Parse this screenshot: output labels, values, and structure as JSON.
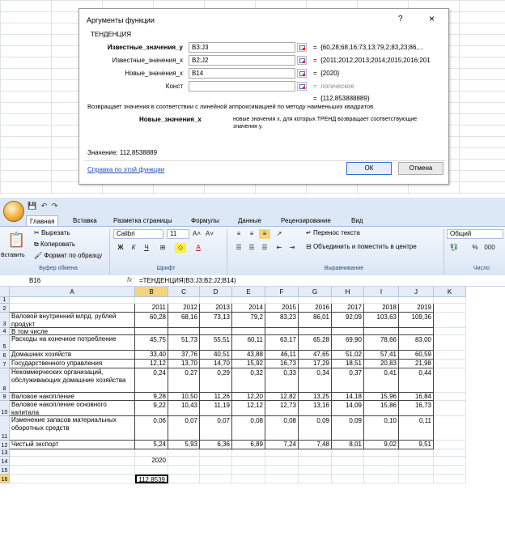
{
  "dialog": {
    "title": "Аргументы функции",
    "help": "?",
    "close": "×",
    "function_name": "ТЕНДЕНЦИЯ",
    "args": [
      {
        "label": "Известные_значения_y",
        "bold": true,
        "value": "B3:J3",
        "result": "{60,28;68,16;73,13;79,2;83,23;86,..."
      },
      {
        "label": "Известные_значения_x",
        "bold": false,
        "value": "B2:J2",
        "result": "{2011;2012;2013;2014;2015;2016;201"
      },
      {
        "label": "Новые_значения_x",
        "bold": false,
        "value": "B14",
        "result": "{2020}"
      },
      {
        "label": "Конст",
        "bold": false,
        "value": "",
        "result": "логическое"
      }
    ],
    "equals": "=",
    "total_result": "{112,853888889}",
    "description": "Возвращает значения в соответствии с линейной аппроксимацией по методу наименьших квадратов.",
    "arg_desc_name": "Новые_значения_x",
    "arg_desc_text": "новые значения x, для которых ТРЕНД возвращает соответствующие значения y.",
    "value_line": "Значение:  112,8538889",
    "help_link": "Справка по этой функции",
    "ok": "ОК",
    "cancel": "Отмена"
  },
  "qat": {
    "save": "💾",
    "undo": "↶",
    "redo": "↷"
  },
  "tabs": [
    "Главная",
    "Вставка",
    "Разметка страницы",
    "Формулы",
    "Данные",
    "Рецензирование",
    "Вид"
  ],
  "ribbon": {
    "clipboard": {
      "paste": "Вставить",
      "cut": "Вырезать",
      "copy": "Копировать",
      "painter": "Формат по образцу",
      "group": "Буфер обмена"
    },
    "font": {
      "name": "Calibri",
      "size": "11",
      "grow": "A˄",
      "shrink": "A˅",
      "bold": "Ж",
      "italic": "К",
      "underline": "Ч",
      "group": "Шрифт"
    },
    "align": {
      "wrap": "Перенос текста",
      "merge": "Объединить и поместить в центре",
      "group": "Выравнивание"
    },
    "number": {
      "format": "Общий",
      "percent": "%",
      "thousands": "000",
      "group": "Число"
    }
  },
  "formula_bar": {
    "name_box": "B16",
    "fx": "fx",
    "formula": "=ТЕНДЕНЦИЯ(B3:J3;B2:J2;B14)"
  },
  "columns": [
    "A",
    "B",
    "C",
    "D",
    "E",
    "F",
    "G",
    "H",
    "I",
    "J",
    "K"
  ],
  "rows": [
    {
      "n": "1",
      "label": "",
      "vals": [
        "",
        "",
        "",
        "",
        "",
        "",
        "",
        "",
        ""
      ]
    },
    {
      "n": "2",
      "label": "",
      "vals": [
        "2011",
        "2012",
        "2013",
        "2014",
        "2015",
        "2016",
        "2017",
        "2018",
        "2019"
      ]
    },
    {
      "n": "3",
      "label": "Валовой внутренний млрд. рублей продукт",
      "vals": [
        "60,28",
        "68,16",
        "73,13",
        "79,2",
        "83,23",
        "86,01",
        "92,09",
        "103,63",
        "109,36"
      ]
    },
    {
      "n": "4",
      "label": "В том числе",
      "vals": [
        "",
        "",
        "",
        "",
        "",
        "",
        "",
        "",
        ""
      ]
    },
    {
      "n": "5",
      "label": "Расходы на конечное потребление",
      "vals": [
        "45,75",
        "51,73",
        "55,51",
        "60,11",
        "63,17",
        "65,28",
        "69,90",
        "78,66",
        "83,00"
      ]
    },
    {
      "n": "6",
      "label": "Домашних хозяйств",
      "vals": [
        "33,40",
        "37,76",
        "40,51",
        "43,88",
        "46,11",
        "47,65",
        "51,02",
        "57,41",
        "60,59"
      ]
    },
    {
      "n": "7",
      "label": "Государственного управления",
      "vals": [
        "12,12",
        "13,70",
        "14,70",
        "15,92",
        "16,73",
        "17,29",
        "18,51",
        "20,83",
        "21,98"
      ]
    },
    {
      "n": "8",
      "label": "Некоммерческих организаций, обслуживающих домашние хозяйства",
      "vals": [
        "0,24",
        "0,27",
        "0,29",
        "0,32",
        "0,33",
        "0,34",
        "0,37",
        "0,41",
        "0,44"
      ]
    },
    {
      "n": "9",
      "label": "Валовое накопление",
      "vals": [
        "9,28",
        "10,50",
        "11,26",
        "12,20",
        "12,82",
        "13,25",
        "14,18",
        "15,96",
        "16,84"
      ]
    },
    {
      "n": "10",
      "label": "Валовое накопление основного капитала",
      "vals": [
        "9,22",
        "10,43",
        "11,19",
        "12,12",
        "12,73",
        "13,16",
        "14,09",
        "15,86",
        "16,73"
      ]
    },
    {
      "n": "11",
      "label": "Изменение запасов материальных оборотных средств",
      "vals": [
        "0,06",
        "0,07",
        "0,07",
        "0,08",
        "0,08",
        "0,09",
        "0,09",
        "0,10",
        "0,11"
      ]
    },
    {
      "n": "12",
      "label": "Чистый экспорт",
      "vals": [
        "5,24",
        "5,93",
        "6,36",
        "6,89",
        "7,24",
        "7,48",
        "8,01",
        "9,02",
        "9,51"
      ]
    },
    {
      "n": "13",
      "label": "",
      "vals": [
        "",
        "",
        "",
        "",
        "",
        "",
        "",
        "",
        ""
      ]
    },
    {
      "n": "14",
      "label": "",
      "vals": [
        "2020",
        "",
        "",
        "",
        "",
        "",
        "",
        "",
        ""
      ]
    },
    {
      "n": "15",
      "label": "",
      "vals": [
        "",
        "",
        "",
        "",
        "",
        "",
        "",
        "",
        ""
      ]
    },
    {
      "n": "16",
      "label": "",
      "vals": [
        "112,8539",
        "",
        "",
        "",
        "",
        "",
        "",
        "",
        ""
      ]
    }
  ]
}
